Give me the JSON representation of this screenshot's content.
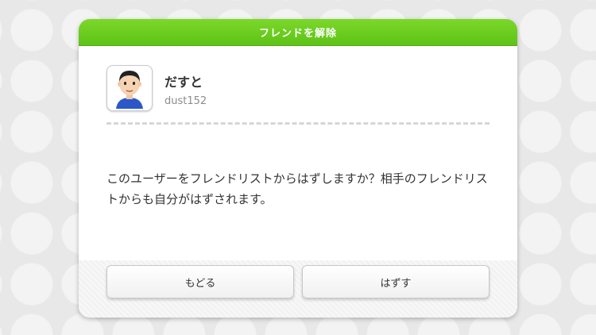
{
  "dialog": {
    "title": "フレンドを解除",
    "user": {
      "name": "だすと",
      "id": "dust152"
    },
    "message": "このユーザーをフレンドリストからはずしますか？相手のフレンドリストからも自分がはずされます。",
    "buttons": {
      "back_label": "もどる",
      "remove_label": "はずす"
    },
    "colors": {
      "header_green": "#6ccf1f",
      "background": "#e9e9e9"
    }
  }
}
